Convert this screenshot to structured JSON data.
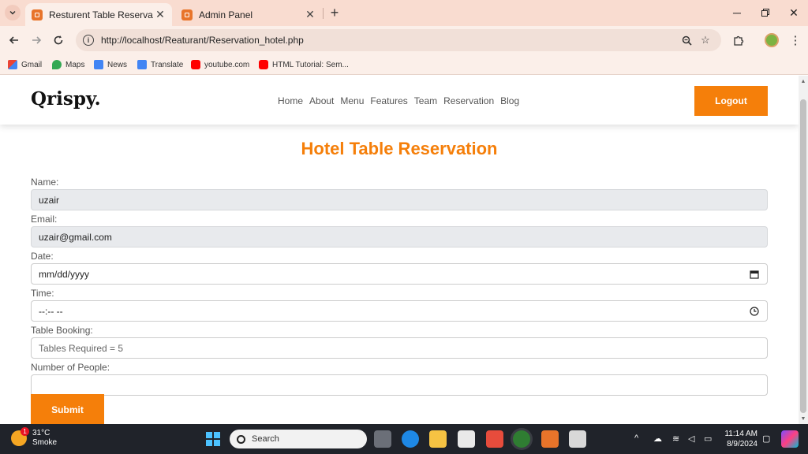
{
  "browser": {
    "tabs": [
      {
        "title": "Resturent Table Reservation",
        "active": true
      },
      {
        "title": "Admin Panel",
        "active": false
      }
    ],
    "url": "http://localhost/Reaturant/Reservation_hotel.php",
    "bookmarks": [
      "Gmail",
      "Maps",
      "News",
      "Translate",
      "youtube.com",
      "HTML Tutorial: Sem..."
    ]
  },
  "site": {
    "logo": "Qrispy.",
    "nav": [
      "Home",
      "About",
      "Menu",
      "Features",
      "Team",
      "Reservation",
      "Blog"
    ],
    "logout_label": "Logout"
  },
  "form": {
    "heading": "Hotel Table Reservation",
    "name_label": "Name:",
    "name_value": "uzair",
    "email_label": "Email:",
    "email_value": "uzair@gmail.com",
    "date_label": "Date:",
    "date_value": "mm/dd/yyyy",
    "time_label": "Time:",
    "time_value": "--:-- --",
    "table_label": "Table Booking:",
    "table_placeholder": "Tables Required = 5",
    "people_label": "Number of People:",
    "people_value": "",
    "submit_label": "Submit"
  },
  "taskbar": {
    "temperature": "31°C",
    "weather": "Smoke",
    "weather_badge": "1",
    "search_placeholder": "Search",
    "time": "11:14 AM",
    "date": "8/9/2024"
  },
  "colors": {
    "accent": "#f57f0a",
    "tabstrip": "#f9dcd0",
    "taskbar": "#20232a"
  }
}
